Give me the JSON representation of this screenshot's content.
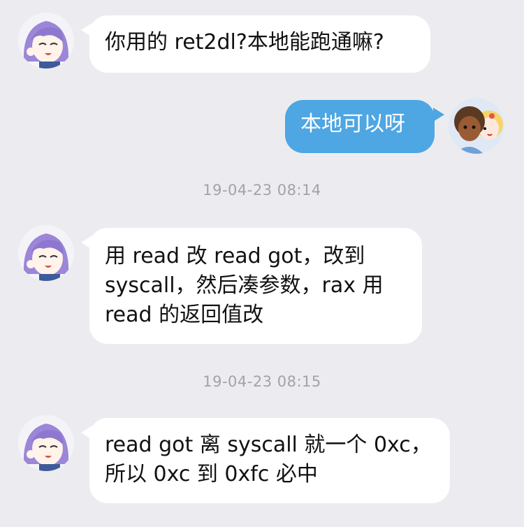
{
  "messages": [
    {
      "sender": "peer",
      "text": "你用的 ret2dl?本地能跑通嘛?"
    },
    {
      "sender": "me",
      "text": "本地可以呀"
    },
    {
      "type": "timestamp",
      "text": "19-04-23 08:14"
    },
    {
      "sender": "peer",
      "text": "用 read 改 read got，改到\nsyscall，然后凑参数，rax 用\nread 的返回值改"
    },
    {
      "type": "timestamp",
      "text": "19-04-23 08:15"
    },
    {
      "sender": "peer",
      "text": "read got 离 syscall 就一个 0xc，\n所以 0xc 到 0xfc 必中"
    }
  ],
  "avatars": {
    "peer": "purple-hair-anime-girl-avatar",
    "me": "two-cartoon-kids-avatar"
  },
  "colors": {
    "background": "#ececf0",
    "peer_bubble": "#ffffff",
    "me_bubble": "#4ea6e2",
    "timestamp": "#a2a2a8"
  }
}
